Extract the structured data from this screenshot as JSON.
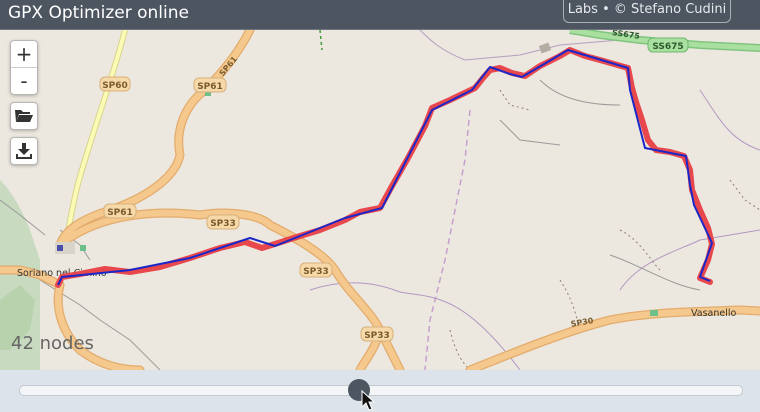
{
  "app": {
    "title": "GPX Optimizer online",
    "credits": "Labs • © Stefano Cudini"
  },
  "controls": {
    "zoom_in": "+",
    "zoom_out": "-",
    "open_icon": "folder-open-icon",
    "save_icon": "download-icon"
  },
  "map": {
    "roads": {
      "sp60": "SP60",
      "sp61_top": "SP61",
      "sp61_mid": "SP61",
      "sp61_left": "SP61",
      "sp33_a": "SP33",
      "sp33_b": "SP33",
      "sp33_c": "SP33",
      "sp30": "SP30",
      "ss675_a": "SS675",
      "ss675_b": "SS675"
    },
    "places": {
      "soriano": "Soriano nel Cimino",
      "vasanello": "Vasanello"
    },
    "colors": {
      "original_track": "#e8474c",
      "optimized_track": "#1c27c8",
      "road": "#f5c98d",
      "road_casing": "#e3ab6c",
      "land": "#ece8df"
    }
  },
  "status": {
    "nodes_text": "42 nodes"
  },
  "slider": {
    "value": 0.47
  }
}
